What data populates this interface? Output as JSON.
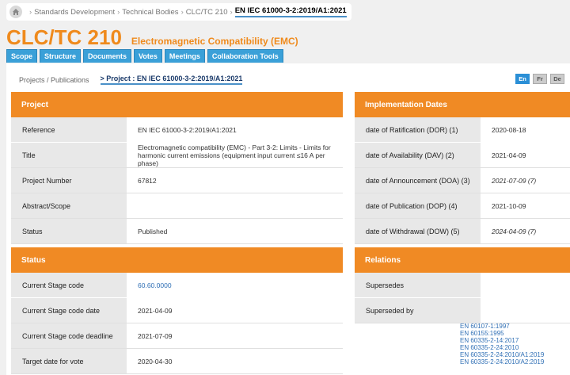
{
  "breadcrumb": [
    "Standards Development",
    "Technical Bodies",
    "CLC/TC 210",
    "EN IEC 61000-3-2:2019/A1:2021"
  ],
  "title": "CLC/TC 210",
  "subtitle": "Electromagnetic Compatibility (EMC)",
  "tabs": [
    "Scope",
    "Structure",
    "Documents",
    "Votes",
    "Meetings",
    "Collaboration Tools"
  ],
  "projects_link": "Projects / Publications",
  "current_project": "> Project : EN IEC 61000-3-2:2019/A1:2021",
  "languages": [
    "En",
    "Fr",
    "De"
  ],
  "project": {
    "header": "Project",
    "rows": [
      {
        "label": "Reference",
        "value": "EN IEC 61000-3-2:2019/A1:2021"
      },
      {
        "label": "Title",
        "value": "Electromagnetic compatibility (EMC) - Part 3-2: Limits - Limits for harmonic current emissions (equipment input current ≤16 A per phase)"
      },
      {
        "label": "Project Number",
        "value": "67812"
      },
      {
        "label": "Abstract/Scope",
        "value": ""
      },
      {
        "label": "Status",
        "value": "Published"
      }
    ]
  },
  "implementation": {
    "header": "Implementation Dates",
    "rows": [
      {
        "label": "date of Ratification (DOR) (1)",
        "value": "2020-08-18"
      },
      {
        "label": "date of Availability (DAV) (2)",
        "value": "2021-04-09"
      },
      {
        "label": "date of Announcement (DOA) (3)",
        "value": "2021-07-09 (7)"
      },
      {
        "label": "date of Publication (DOP) (4)",
        "value": "2021-10-09"
      },
      {
        "label": "date of Withdrawal (DOW) (5)",
        "value": "2024-04-09 (7)"
      }
    ]
  },
  "status": {
    "header": "Status",
    "rows": [
      {
        "label": "Current Stage code",
        "value": "60.60.0000"
      },
      {
        "label": "Current Stage code date",
        "value": "2021-04-09"
      },
      {
        "label": "Current Stage code deadline",
        "value": "2021-07-09"
      },
      {
        "label": "Target date for vote",
        "value": "2020-04-30"
      }
    ]
  },
  "relations": {
    "header": "Relations",
    "rows": [
      {
        "label": "Supersedes",
        "value": ""
      },
      {
        "label": "Superseded by",
        "value": ""
      }
    ],
    "links": [
      "EN 60107-1:1997",
      "EN 60155:1995",
      "EN 60335-2-14:2017",
      "EN 60335-2-24:2010",
      "EN 60335-2-24:2010/A1:2019",
      "EN 60335-2-24:2010/A2:2019"
    ]
  },
  "colors": {
    "accent": "#f08a24",
    "tab": "#3aa0d8",
    "link": "#2f6fb5"
  }
}
